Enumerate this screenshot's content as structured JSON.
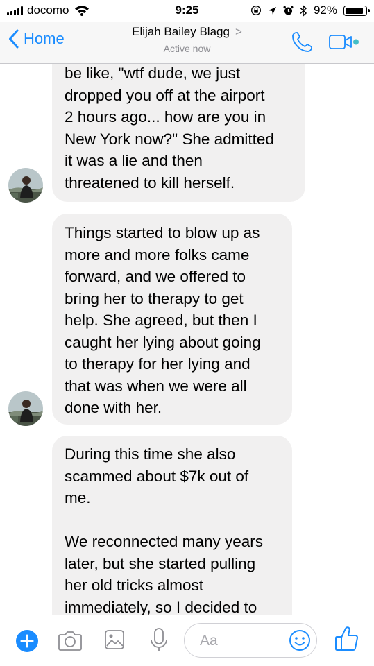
{
  "status_bar": {
    "carrier": "docomo",
    "time": "9:25",
    "battery": "92%",
    "battery_level": 0.92
  },
  "nav": {
    "back_label": "Home",
    "contact_name": "Elijah Bailey Blagg",
    "contact_chevron": ">",
    "presence": "Active now"
  },
  "messages": [
    {
      "sender": "Elijah Bailey Blagg",
      "text": "be like, \"wtf dude, we just\ndropped you off at the airport\n2 hours ago... how are you in\nNew York now?\" She admitted\nit was a lie and then\nthreatened to kill herself."
    },
    {
      "sender": "Elijah Bailey Blagg",
      "text": "Things started to blow up as\nmore and more folks came\nforward, and we offered to\nbring her to therapy to get\nhelp. She agreed, but then I\ncaught her lying about going\nto therapy for her lying and\nthat was when we were all\ndone with her."
    },
    {
      "sender": "Elijah Bailey Blagg",
      "text": "During this time she also\nscammed about $7k out of\nme.\n\nWe reconnected many years\nlater, but she started pulling\nher old tricks almost\nimmediately, so I decided to"
    }
  ],
  "composer": {
    "placeholder": "Aa",
    "icons": [
      "plus-icon",
      "camera-icon",
      "image-icon",
      "microphone-icon",
      "emoji-icon",
      "thumbs-up-icon"
    ]
  },
  "colors": {
    "accent": "#1a8cff",
    "bubble": "#f1f0f0",
    "active_dot": "#44bec7",
    "muted_text": "#8e8e93"
  }
}
